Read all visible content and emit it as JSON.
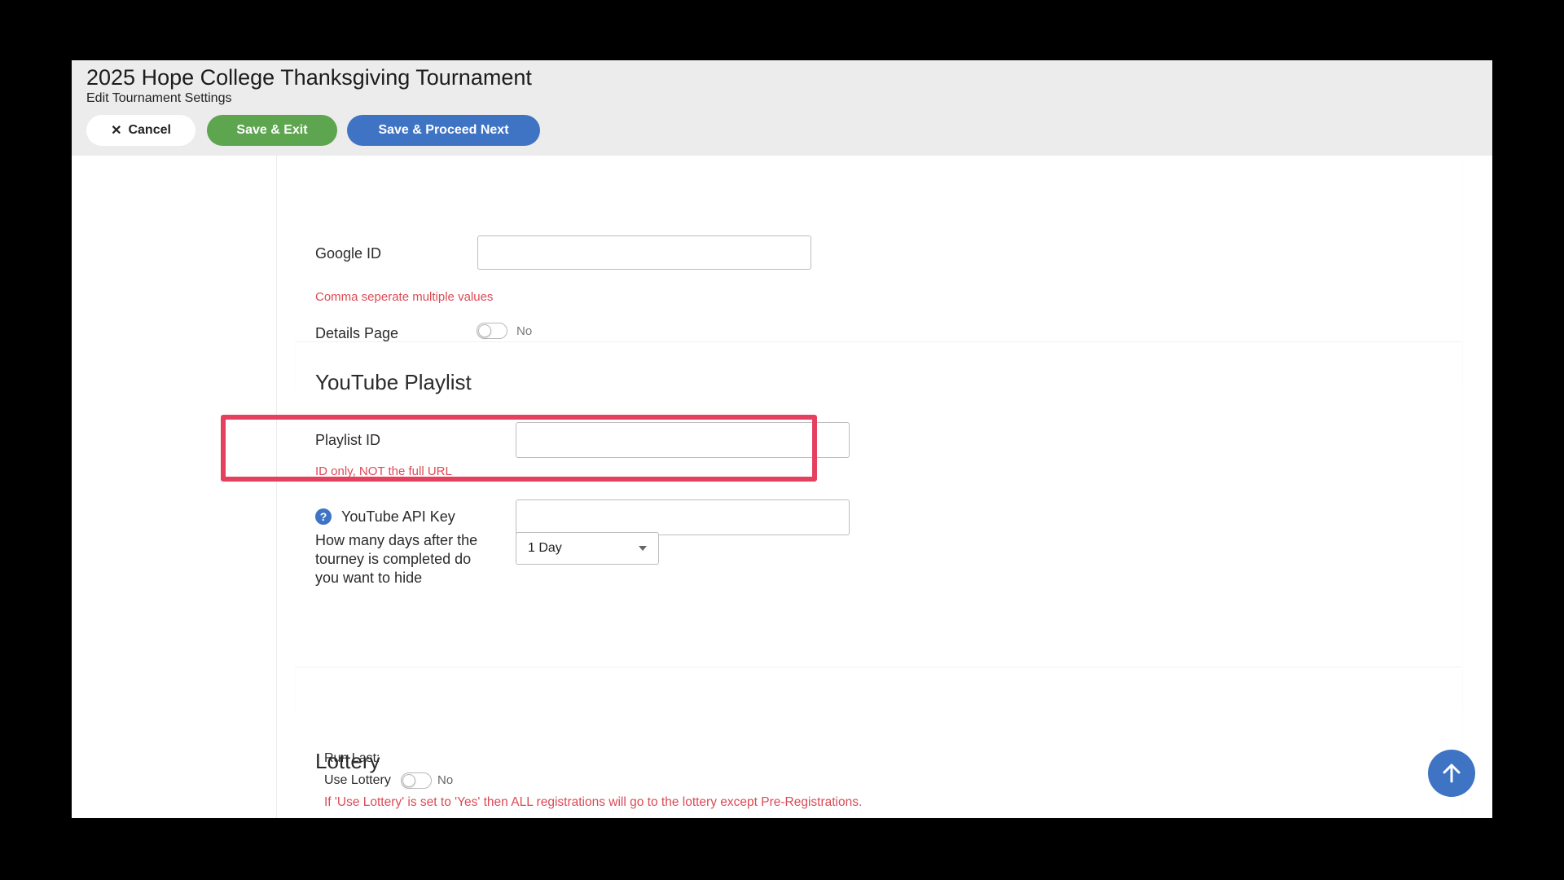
{
  "header": {
    "title": "2025 Hope College Thanksgiving Tournament",
    "subtitle": "Edit Tournament Settings",
    "cancel_label": "Cancel",
    "save_exit_label": "Save & Exit",
    "save_next_label": "Save & Proceed Next"
  },
  "google": {
    "id_label": "Google ID",
    "id_value": "",
    "hint": "Comma seperate multiple values",
    "details_label": "Details Page",
    "details_state": "No"
  },
  "youtube": {
    "title": "YouTube Playlist",
    "playlist_label": "Playlist ID",
    "playlist_value": "",
    "playlist_hint": "ID only, NOT the full URL",
    "api_key_label": "YouTube API Key",
    "api_key_value": "",
    "hide_label": "How many days after the tourney is completed do you want to hide",
    "hide_value": "1 Day"
  },
  "lottery": {
    "title": "Lottery",
    "run_last_label": "Run Last:",
    "use_label": "Use Lottery",
    "use_state": "No",
    "warning": "If 'Use Lottery' is set to 'Yes' then ALL registrations will go to the lottery except Pre-Registrations."
  },
  "icons": {
    "cancel": "close-icon",
    "help": "help-icon",
    "scroll_top": "arrow-up-icon"
  },
  "colors": {
    "save_exit": "#5da54f",
    "primary": "#3f74c4",
    "hint": "#dc4a55",
    "highlight": "#e5415e"
  }
}
